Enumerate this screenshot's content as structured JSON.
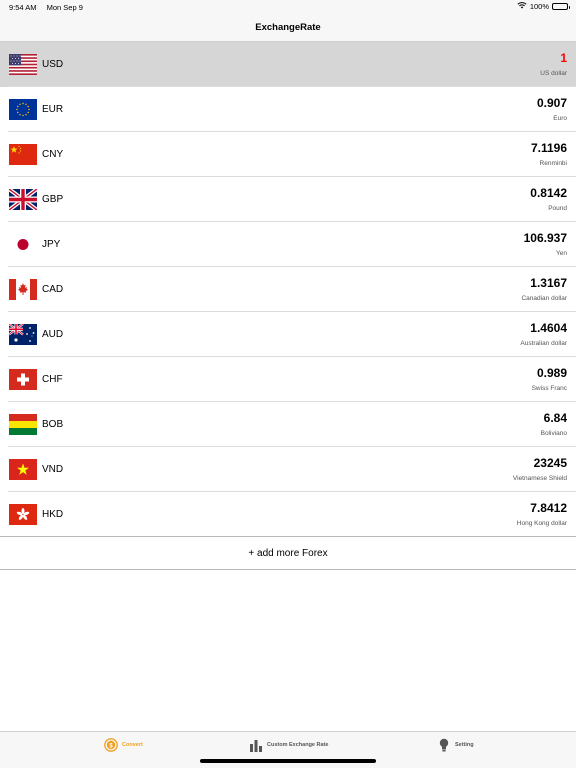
{
  "status": {
    "time": "9:54 AM",
    "date": "Mon Sep 9",
    "battery": "100%"
  },
  "nav": {
    "title": "ExchangeRate"
  },
  "currencies": [
    {
      "code": "USD",
      "rate": "1",
      "name": "US dollar",
      "flag": "us-flag"
    },
    {
      "code": "EUR",
      "rate": "0.907",
      "name": "Euro",
      "flag": "eu-flag"
    },
    {
      "code": "CNY",
      "rate": "7.1196",
      "name": "Renminbi",
      "flag": "cn-flag"
    },
    {
      "code": "GBP",
      "rate": "0.8142",
      "name": "Pound",
      "flag": "gb-flag"
    },
    {
      "code": "JPY",
      "rate": "106.937",
      "name": "Yen",
      "flag": "jp-flag"
    },
    {
      "code": "CAD",
      "rate": "1.3167",
      "name": "Canadian dollar",
      "flag": "ca-flag"
    },
    {
      "code": "AUD",
      "rate": "1.4604",
      "name": "Australian dollar",
      "flag": "au-flag"
    },
    {
      "code": "CHF",
      "rate": "0.989",
      "name": "Swiss Franc",
      "flag": "ch-flag"
    },
    {
      "code": "BOB",
      "rate": "6.84",
      "name": "Boliviano",
      "flag": "bo-flag"
    },
    {
      "code": "VND",
      "rate": "23245",
      "name": "Vietnamese Shield",
      "flag": "vn-flag"
    },
    {
      "code": "HKD",
      "rate": "7.8412",
      "name": "Hong Kong dollar",
      "flag": "hk-flag"
    }
  ],
  "add_more_label": "+ add more Forex",
  "tabs": [
    {
      "label": "Convert",
      "icon": "coin-icon"
    },
    {
      "label": "Custom Exchange Rate",
      "icon": "bar-chart-icon"
    },
    {
      "label": "Setting",
      "icon": "lightbulb-icon"
    }
  ],
  "colors": {
    "accent": "#f0a020",
    "base_rate": "#ff0000",
    "selected_row": "#d6d6d6"
  }
}
